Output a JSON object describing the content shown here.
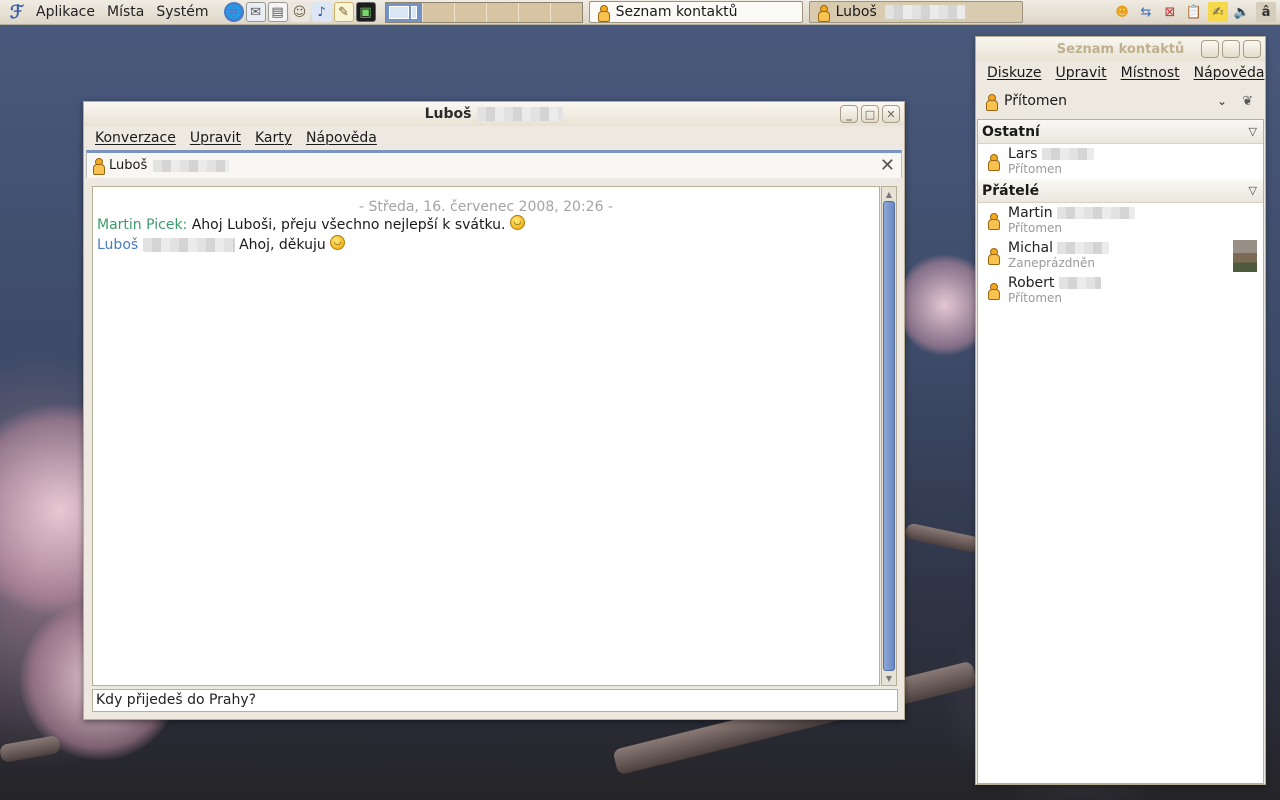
{
  "top_panel": {
    "menus": [
      "Aplikace",
      "Místa",
      "Systém"
    ],
    "launchers": [
      {
        "icon": "globe-icon",
        "glyph": "🌐"
      },
      {
        "icon": "mail-icon",
        "glyph": "✉"
      },
      {
        "icon": "presentation-icon",
        "glyph": "▤"
      },
      {
        "icon": "people-icon",
        "glyph": "☺"
      },
      {
        "icon": "music-icon",
        "glyph": "♪"
      },
      {
        "icon": "notes-icon",
        "glyph": "✎"
      },
      {
        "icon": "terminal-icon",
        "glyph": "▣"
      }
    ],
    "tasks": [
      {
        "label": "Seznam kontaktů"
      },
      {
        "label": "Luboš"
      }
    ],
    "tray": [
      {
        "icon": "pidgin-tray-icon",
        "glyph": "☻"
      },
      {
        "icon": "network-icon",
        "glyph": "⇆"
      },
      {
        "icon": "network-offline-icon",
        "glyph": "⊠"
      },
      {
        "icon": "clipboard-icon",
        "glyph": "📋"
      },
      {
        "icon": "notes-tray-icon",
        "glyph": "✍"
      },
      {
        "icon": "volume-icon",
        "glyph": "🔈"
      },
      {
        "icon": "user-switch-icon",
        "glyph": "â"
      }
    ]
  },
  "chat": {
    "window_title": "Luboš",
    "menus": [
      "Konverzace",
      "Upravit",
      "Karty",
      "Nápověda"
    ],
    "tab_label": "Luboš",
    "date_line": "- Středa, 16. červenec 2008, 20:26 -",
    "messages": [
      {
        "nick": "Martin Picek:",
        "text": "Ahoj Luboši, přeju všechno nejlepší k svátku.",
        "mine": false
      },
      {
        "nick": "Luboš",
        "text": "Ahoj, děkuju",
        "mine": true
      }
    ],
    "input_value": "Kdy přijedeš do Prahy?"
  },
  "contacts": {
    "window_title": "Seznam kontaktů",
    "menus": [
      "Diskuze",
      "Upravit",
      "Místnost",
      "Nápověda"
    ],
    "status": "Přítomen",
    "groups": [
      {
        "name": "Ostatní",
        "buddies": [
          {
            "name": "Lars",
            "status": "Přítomen",
            "avatar": false
          }
        ]
      },
      {
        "name": "Přátelé",
        "buddies": [
          {
            "name": "Martin",
            "status": "Přítomen",
            "avatar": false
          },
          {
            "name": "Michal",
            "status": "Zaneprázdněn",
            "avatar": true
          },
          {
            "name": "Robert",
            "status": "Přítomen",
            "avatar": false
          }
        ]
      }
    ]
  },
  "colors": {
    "accent": "#7393c6",
    "nick_other": "#3c9b6b",
    "nick_me": "#4a7cc0",
    "panel": "#e6e0d3"
  }
}
